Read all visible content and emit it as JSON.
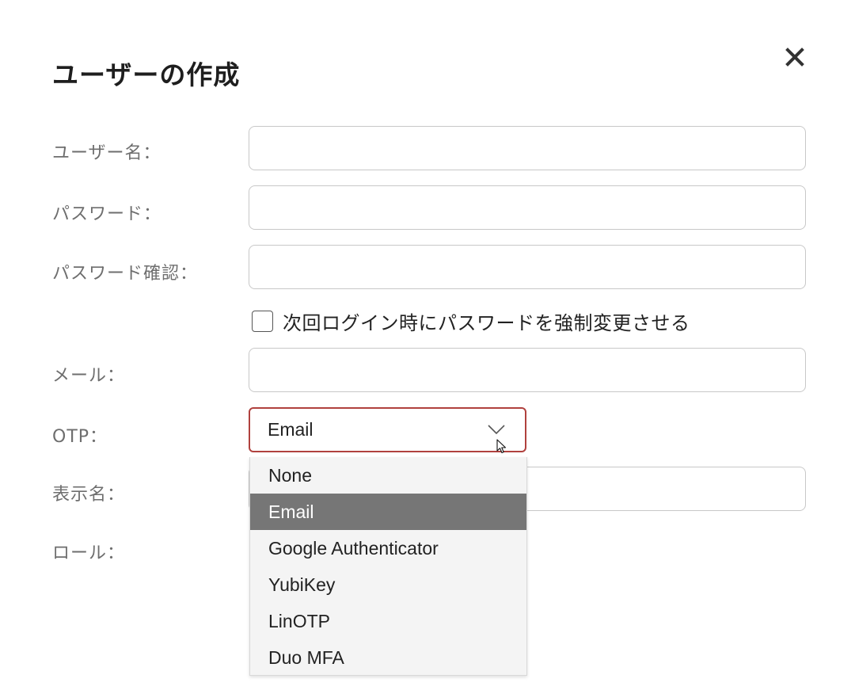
{
  "dialog": {
    "title": "ユーザーの作成",
    "close_label": "×"
  },
  "form": {
    "username": {
      "label": "ユーザー名：",
      "value": ""
    },
    "password": {
      "label": "パスワード：",
      "value": ""
    },
    "password_confirm": {
      "label": "パスワード確認：",
      "value": ""
    },
    "force_change": {
      "label": "次回ログイン時にパスワードを強制変更させる",
      "checked": false
    },
    "email": {
      "label": "メール：",
      "value": ""
    },
    "otp": {
      "label": "OTP：",
      "selected": "Email",
      "options": [
        "None",
        "Email",
        "Google Authenticator",
        "YubiKey",
        "LinOTP",
        "Duo MFA"
      ],
      "selected_index": 1
    },
    "display_name": {
      "label": "表示名：",
      "value": ""
    },
    "role": {
      "label": "ロール："
    }
  },
  "colors": {
    "accent_border": "#b0413e",
    "selected_option_bg": "#767676",
    "label_text": "#6e6e6e"
  }
}
